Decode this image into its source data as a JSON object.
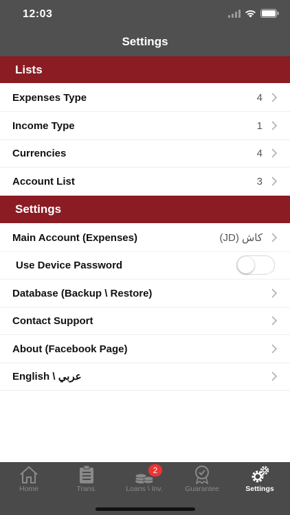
{
  "status_bar": {
    "time": "12:03"
  },
  "nav": {
    "title": "Settings"
  },
  "lists_section": {
    "header": "Lists",
    "rows": [
      {
        "label": "Expenses Type",
        "value": "4"
      },
      {
        "label": "Income Type",
        "value": "1"
      },
      {
        "label": "Currencies",
        "value": "4"
      },
      {
        "label": "Account List",
        "value": "3"
      }
    ]
  },
  "settings_section": {
    "header": "Settings",
    "main_account": {
      "label": "Main Account (Expenses)",
      "value": "كاش (JD)"
    },
    "device_password": {
      "label": "Use Device Password",
      "enabled": false
    },
    "database": {
      "label": "Database (Backup \\ Restore)"
    },
    "contact": {
      "label": "Contact Support"
    },
    "about": {
      "label": "About (Facebook Page)"
    },
    "language": {
      "label": "English \\ عربي"
    }
  },
  "tabbar": {
    "items": [
      {
        "label": "Home",
        "icon": "home-icon"
      },
      {
        "label": "Trans.",
        "icon": "transactions-icon"
      },
      {
        "label": "Loans \\ Inv.",
        "icon": "coins-icon",
        "badge": "2"
      },
      {
        "label": "Guarantee",
        "icon": "guarantee-badge-icon"
      },
      {
        "label": "Settings",
        "icon": "gears-icon",
        "active": true
      }
    ]
  },
  "colors": {
    "accent": "#8b1c24",
    "bar": "#505050",
    "tabbar": "#4a4a4a"
  }
}
